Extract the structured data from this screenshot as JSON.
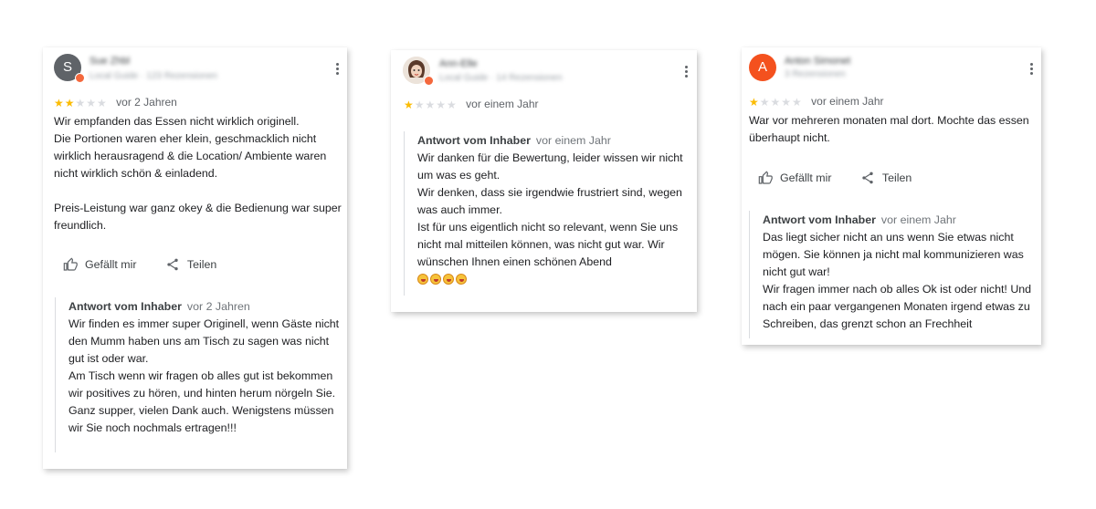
{
  "reviews": [
    {
      "avatar": {
        "letter": "S",
        "color": "#5f6368",
        "has_badge": true
      },
      "reviewer_name": "Sue Zhbl",
      "reviewer_sub": "Local Guide · 123 Rezensionen",
      "stars": {
        "filled": 2,
        "total": 5
      },
      "time_ago": "vor 2 Jahren",
      "text": "Wir empfanden das Essen nicht wirklich originell.\nDie Portionen waren eher klein, geschmacklich nicht wirklich herausragend & die Location/ Ambiente waren nicht wirklich schön & einladend.\n\nPreis-Leistung war ganz okey & die Bedienung war super freundlich.",
      "actions": {
        "like": "Gefällt mir",
        "share": "Teilen"
      },
      "owner_reply": {
        "title": "Antwort vom Inhaber",
        "time_ago": "vor 2 Jahren",
        "text": "Wir finden es immer super Originell, wenn Gäste nicht den Mumm haben uns am Tisch zu sagen was nicht gut ist oder war.\nAm Tisch wenn wir fragen ob alles gut ist bekommen wir positives zu hören, und hinten herum nörgeln Sie. Ganz supper, vielen Dank auch. Wenigstens müssen wir Sie noch nochmals ertragen!!!"
      }
    },
    {
      "avatar": {
        "letter": "",
        "color": "#e8dcd2",
        "has_badge": true
      },
      "reviewer_name": "Ann-Elle",
      "reviewer_sub": "Local Guide · 14 Rezensionen",
      "stars": {
        "filled": 1,
        "total": 5
      },
      "time_ago": "vor einem Jahr",
      "owner_reply": {
        "title": "Antwort vom Inhaber",
        "time_ago": "vor einem Jahr",
        "text": "Wir danken für die Bewertung, leider wissen wir nicht um was es geht.\nWir denken, dass sie irgendwie frustriert sind, wegen was auch immer.\nIst für uns eigentlich nicht so relevant, wenn Sie uns nicht mal mitteilen können, was nicht gut war. Wir wünschen Ihnen einen schönen Abend",
        "emoji_count": 4
      }
    },
    {
      "avatar": {
        "letter": "A",
        "color": "#f4511e",
        "has_badge": false
      },
      "reviewer_name": "Anton Simonet",
      "reviewer_sub": "3 Rezensionen",
      "stars": {
        "filled": 1,
        "total": 5
      },
      "time_ago": "vor einem Jahr",
      "text": "War vor mehreren monaten mal dort. Mochte das essen überhaupt nicht.",
      "actions": {
        "like": "Gefällt mir",
        "share": "Teilen"
      },
      "owner_reply": {
        "title": "Antwort vom Inhaber",
        "time_ago": "vor einem Jahr",
        "text": "Das liegt sicher nicht an uns wenn Sie etwas nicht mögen. Sie können ja nicht mal kommunizieren was nicht gut war!\nWir fragen immer nach ob alles Ok ist oder nicht! Und nach ein paar vergangenen Monaten irgend etwas zu Schreiben, das grenzt schon an Frechheit"
      }
    }
  ]
}
